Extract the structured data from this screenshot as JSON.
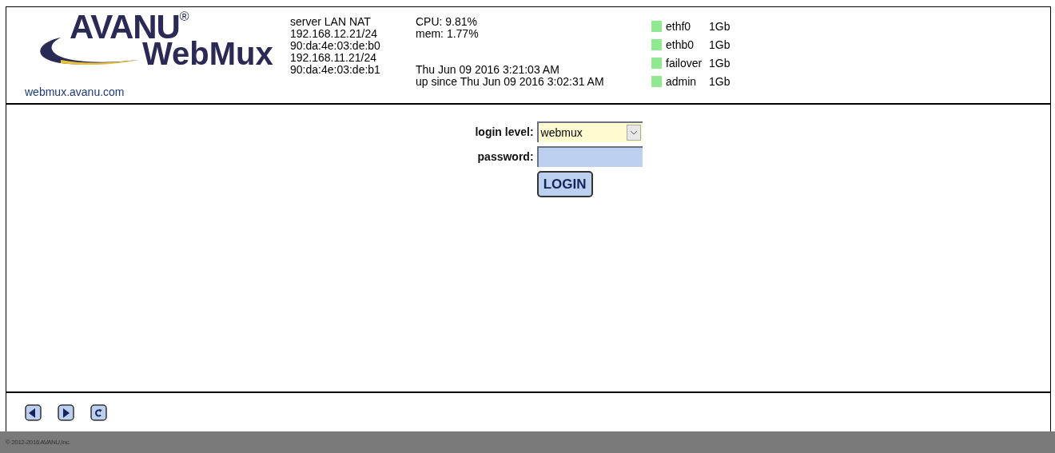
{
  "logo": {
    "brand": "AVANU",
    "registered": "®",
    "product": "WebMux",
    "site": "webmux.avanu.com"
  },
  "network_lines": [
    "server LAN NAT",
    "192.168.12.21/24",
    "90:da:4e:03:de:b0",
    "192.168.11.21/24",
    "90:da:4e:03:de:b1"
  ],
  "stats": {
    "cpu": "CPU: 9.81%",
    "mem": "mem: 1.77%",
    "time": "Thu Jun 09 2016 3:21:03 AM",
    "uptime": "up since Thu Jun 09 2016 3:02:31 AM"
  },
  "interfaces": [
    {
      "name": "ethf0",
      "speed": "1Gb",
      "color": "#90e890"
    },
    {
      "name": "ethb0",
      "speed": "1Gb",
      "color": "#90e890"
    },
    {
      "name": "failover",
      "speed": "1Gb",
      "color": "#90e890"
    },
    {
      "name": "admin",
      "speed": "1Gb",
      "color": "#90e890"
    }
  ],
  "login": {
    "level_label": "login level:",
    "level_value": "webmux",
    "password_label": "password:",
    "button": "LOGIN"
  },
  "nav_buttons": [
    {
      "kind": "back"
    },
    {
      "kind": "forward"
    },
    {
      "kind": "reload"
    }
  ],
  "copyright": "© 2012-2016 AVANU,Inc."
}
